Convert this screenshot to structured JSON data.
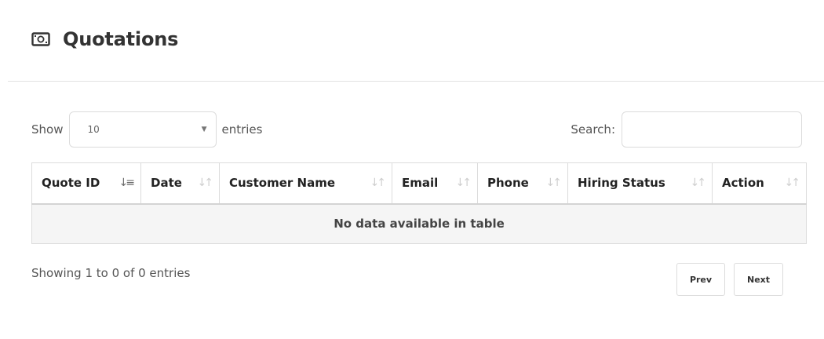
{
  "page": {
    "title": "Quotations",
    "icon": "money-bill-icon"
  },
  "controls": {
    "show_label": "Show",
    "entries_selected": "10",
    "entries_label": "entries",
    "search_label": "Search:",
    "search_value": ""
  },
  "table": {
    "columns": [
      {
        "label": "Quote ID",
        "sort_state": "ascending"
      },
      {
        "label": "Date",
        "sort_state": "unsorted"
      },
      {
        "label": "Customer Name",
        "sort_state": "unsorted"
      },
      {
        "label": "Email",
        "sort_state": "unsorted"
      },
      {
        "label": "Phone",
        "sort_state": "unsorted"
      },
      {
        "label": "Hiring Status",
        "sort_state": "unsorted"
      },
      {
        "label": "Action",
        "sort_state": "unsorted"
      }
    ],
    "empty_message": "No data available in table"
  },
  "footer": {
    "info": "Showing 1 to 0 of 0 entries",
    "prev_label": "Prev",
    "next_label": "Next"
  }
}
